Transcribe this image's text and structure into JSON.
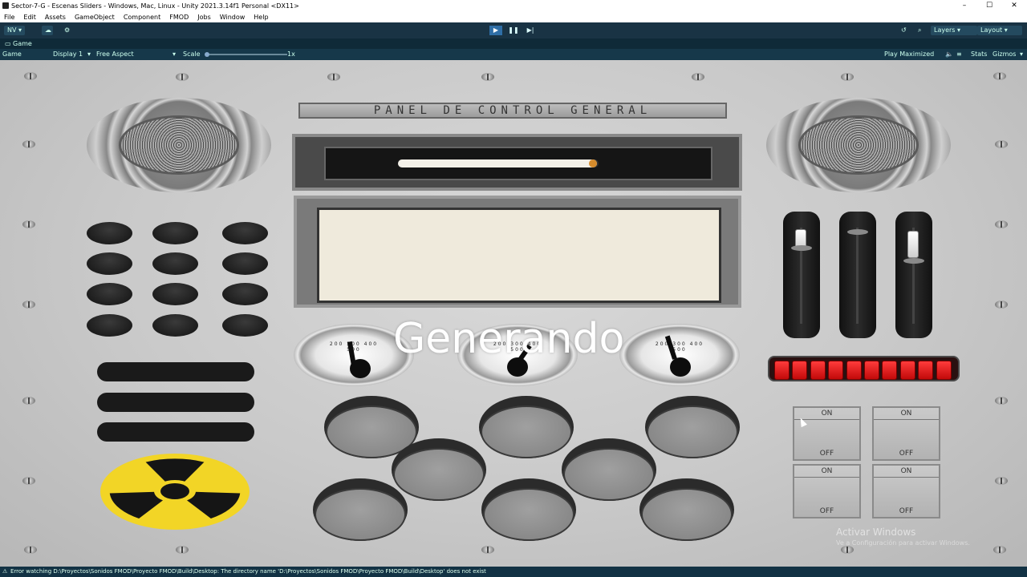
{
  "window": {
    "title": "Sector-7-G - Escenas Sliders - Windows, Mac, Linux - Unity 2021.3.14f1 Personal <DX11>",
    "controls": [
      "–",
      "☐",
      "✕"
    ]
  },
  "menubar": {
    "items": [
      "File",
      "Edit",
      "Assets",
      "GameObject",
      "Component",
      "FMOD",
      "Jobs",
      "Window",
      "Help"
    ]
  },
  "toolbar": {
    "account": "NV",
    "account_arrow": "▾",
    "layers_label": "Layers",
    "layout_label": "Layout",
    "play_icon": "▶",
    "pause_icon": "❚❚",
    "step_icon": "▶|",
    "history_icon": "↺",
    "search_icon": "⌕"
  },
  "game_view": {
    "tab_label": "Game",
    "mode_label": "Game",
    "display_label": "Display 1",
    "aspect_label": "Free Aspect",
    "scale_label": "Scale",
    "scale_value": "1x",
    "play_maximized_label": "Play Maximized",
    "stats_label": "Stats",
    "gizmos_label": "Gizmos",
    "mute_icon": "🔈"
  },
  "panel": {
    "title": "PANEL DE CONTROL GENERAL",
    "progress_fraction": 0.99,
    "overlay_text": "Generando",
    "gauge_numbers": "200 300 400 500",
    "switches": [
      {
        "on": "ON",
        "off": "OFF"
      },
      {
        "on": "ON",
        "off": "OFF"
      },
      {
        "on": "ON",
        "off": "OFF"
      },
      {
        "on": "ON",
        "off": "OFF"
      }
    ],
    "slider_levels": [
      0.75,
      0.85,
      0.65
    ],
    "led_count": 10,
    "accent_colors": {
      "led": "#e01818",
      "radiation": "#f2d526",
      "progress_end": "#d58b2c"
    }
  },
  "watermark": {
    "line1": "Activar Windows",
    "line2": "Ve a Configuración para activar Windows."
  },
  "status_bar": {
    "message": "Error watching D:\\Proyectos\\Sonidos FMOD\\Proyecto FMOD\\Build\\Desktop: The directory name 'D:\\Proyectos\\Sonidos FMOD\\Proyecto FMOD\\Build\\Desktop' does not exist"
  }
}
